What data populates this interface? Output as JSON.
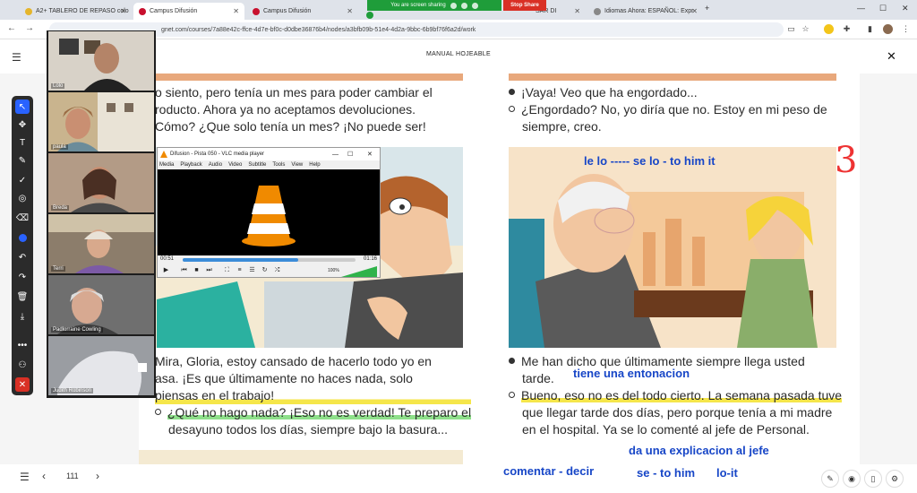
{
  "browser": {
    "tabs": [
      {
        "title": "A2+ TABLERO DE REPASO colo",
        "color": "#e5b52b"
      },
      {
        "title": "Campus Difusión",
        "color": "#c8102e"
      },
      {
        "title": "Campus Difusión",
        "color": "#c8102e"
      },
      {
        "title": "Campus Difusión",
        "color": "#1f9d3a"
      },
      {
        "title": "SAR DI",
        "color": "#cc4444"
      },
      {
        "title": "Idiomas Ahora: ESPAÑOL: Expr",
        "color": "#888888"
      }
    ],
    "new_tab": "+",
    "url": "gnet.com/courses/7a88e42c-ffce-4d7e-bf0c-d0dbe36876b4/nodes/a3bfb09b-51e4-4d2a-9bbc-6b9bf76f6a2d/work",
    "sharing_banner": "You are screen sharing",
    "stop_share": "Stop Share"
  },
  "reader": {
    "title": "MANUAL HOJEABLE",
    "page_number": "111"
  },
  "left_page": {
    "top_lines": [
      "o siento, pero tenía un mes para poder cambiar el",
      "roducto. Ahora ya no aceptamos devoluciones.",
      "Cómo? ¿Que solo tenía un mes? ¡No puede ser!"
    ],
    "bottom_lines": [
      "Mira, Gloria, estoy cansado de hacerlo todo yo en",
      "asa. ¡Es que últimamente no haces nada, solo",
      "piensas en el trabajo!"
    ],
    "bullet_lines": [
      "¿Qué no hago nada? ¡Eso no es verdad! Te preparo el",
      "desayuno todos los días, siempre bajo la basura..."
    ]
  },
  "right_page": {
    "top_lines": [
      "¡Vaya! Veo que ha engordado...",
      "¿Engordado? No, yo diría que no. Estoy en mi peso de",
      "siempre, creo."
    ],
    "bottom_lines": [
      "Me han dicho que últimamente siempre llega usted",
      "tarde."
    ],
    "bullet_lines": [
      "Bueno, eso no es del todo cierto. La semana pasada tuve",
      "que llegar tarde dos días, pero porque tenía a mi madre",
      "en el hospital. Ya se lo comenté al jefe de Personal."
    ]
  },
  "annotations": {
    "le_lo": "le lo ----- se lo - to him it",
    "number_3": "3",
    "entonacion": "tiene una entonacion",
    "explicacion": "da una explicacion al jefe",
    "comentar": "comentar - decir",
    "se_to_him": "se - to him",
    "lo_it": "lo-it"
  },
  "participants": [
    {
      "name": "Lolo",
      "bg": "#d8d2c8"
    },
    {
      "name": "paula",
      "bg": "#c9b48e"
    },
    {
      "name": "Breda",
      "bg": "#b39b86"
    },
    {
      "name": "Terri",
      "bg": "#8c7d6b"
    },
    {
      "name": "Padlorraine Cowling",
      "bg": "#6f6f6f"
    },
    {
      "name": "Judith Robinson",
      "bg": "#9a9da2"
    }
  ],
  "vlc": {
    "title": "Difusion - Pista 050 - VLC media player",
    "menu": [
      "Media",
      "Playback",
      "Audio",
      "Video",
      "Subtitle",
      "Tools",
      "View",
      "Help"
    ],
    "elapsed": "00:51",
    "total": "01:16",
    "volume": "100%",
    "progress": 0.67
  },
  "colors": {
    "accent": "#1746c7",
    "highlight_yellow": "#f5e64a",
    "highlight_green": "#8ee08a",
    "red_mark": "#e33"
  }
}
